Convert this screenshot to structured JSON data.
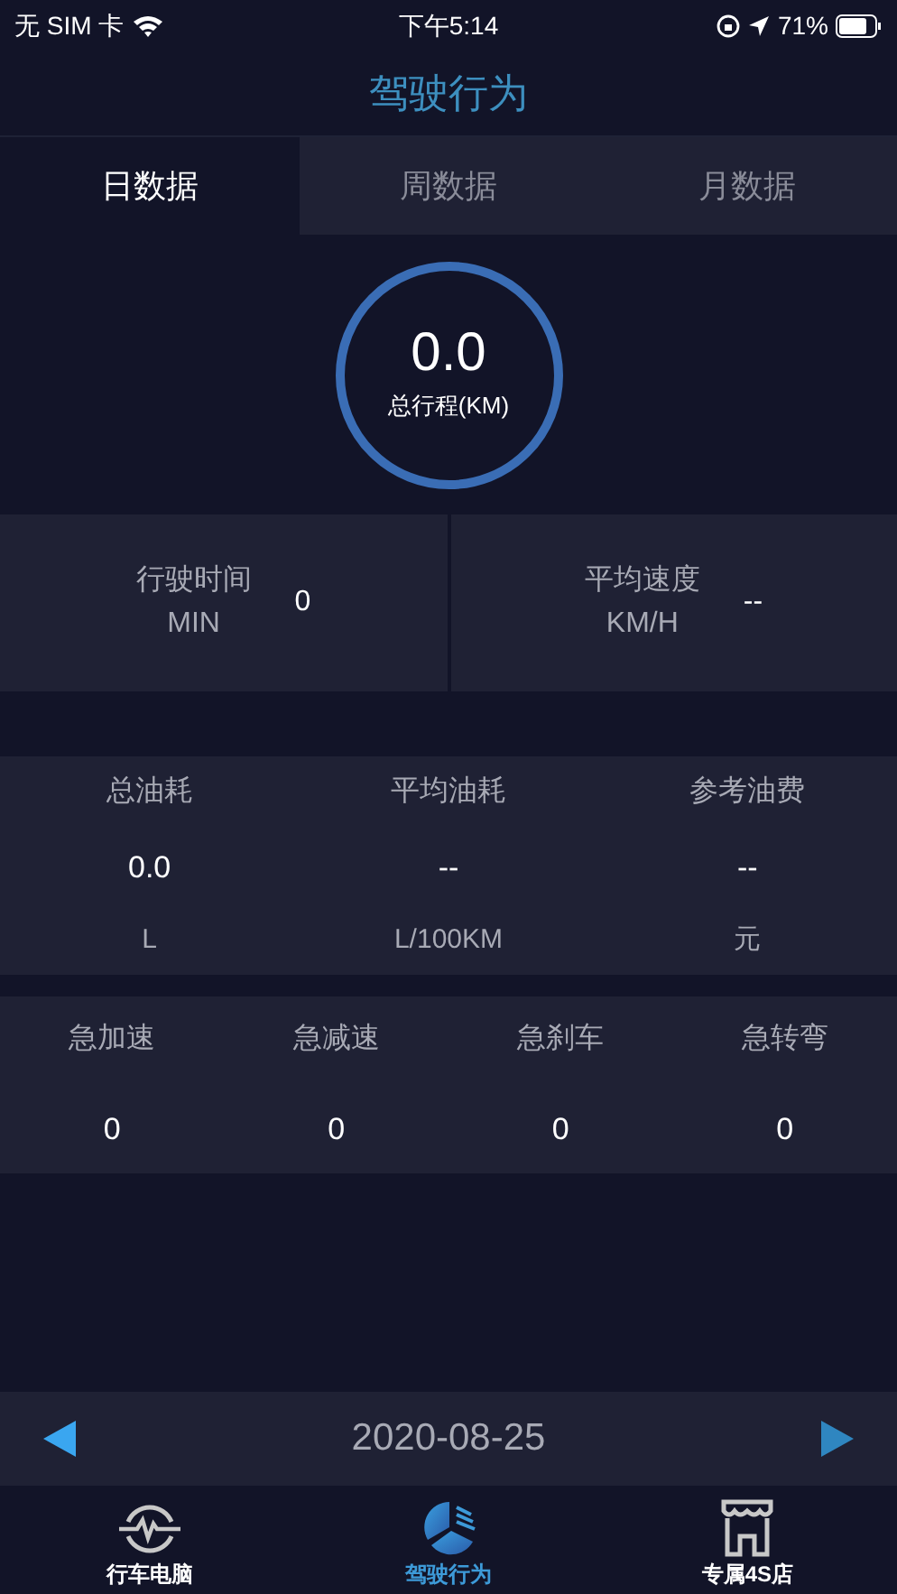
{
  "status_bar": {
    "carrier": "无 SIM 卡",
    "time": "下午5:14",
    "battery": "71%"
  },
  "title": "驾驶行为",
  "tabs": [
    {
      "label": "日数据",
      "selected": true
    },
    {
      "label": "周数据",
      "selected": false
    },
    {
      "label": "月数据",
      "selected": false
    }
  ],
  "total": {
    "value": "0.0",
    "label": "总行程(KM)"
  },
  "time_speed": [
    {
      "label": "行驶时间",
      "unit": "MIN",
      "value": "0"
    },
    {
      "label": "平均速度",
      "unit": "KM/H",
      "value": "--"
    }
  ],
  "fuel": [
    {
      "label": "总油耗",
      "value": "0.0",
      "unit": "L"
    },
    {
      "label": "平均油耗",
      "value": "--",
      "unit": "L/100KM"
    },
    {
      "label": "参考油费",
      "value": "--",
      "unit": "元"
    }
  ],
  "events": [
    {
      "label": "急加速",
      "value": "0"
    },
    {
      "label": "急减速",
      "value": "0"
    },
    {
      "label": "急刹车",
      "value": "0"
    },
    {
      "label": "急转弯",
      "value": "0"
    }
  ],
  "date": "2020-08-25",
  "bottom_tabs": [
    {
      "label": "行车电脑",
      "kind": "pulse",
      "selected": false
    },
    {
      "label": "驾驶行为",
      "kind": "pie",
      "selected": true
    },
    {
      "label": "专属4S店",
      "kind": "shop",
      "selected": false
    }
  ]
}
